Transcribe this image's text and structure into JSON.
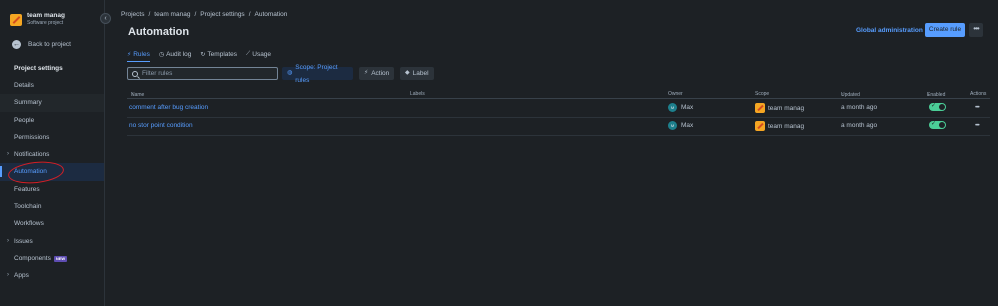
{
  "sidebar": {
    "project_name": "team manag",
    "project_type": "Software project",
    "collapse_icon": "‹",
    "back_label": "Back to project",
    "section_title": "Project settings",
    "items": [
      {
        "label": "Details",
        "chevron": false
      },
      {
        "label": "Summary",
        "chevron": false
      },
      {
        "label": "People",
        "chevron": false
      },
      {
        "label": "Permissions",
        "chevron": false
      },
      {
        "label": "Notifications",
        "chevron": true
      },
      {
        "label": "Automation",
        "chevron": false
      },
      {
        "label": "Features",
        "chevron": false
      },
      {
        "label": "Toolchain",
        "chevron": false
      },
      {
        "label": "Workflows",
        "chevron": false
      },
      {
        "label": "Issues",
        "chevron": true
      },
      {
        "label": "Components",
        "chevron": false,
        "badge": "NEW"
      },
      {
        "label": "Apps",
        "chevron": true
      }
    ]
  },
  "breadcrumb": [
    "Projects",
    "team manag",
    "Project settings",
    "Automation"
  ],
  "page_title": "Automation",
  "header_actions": {
    "global_admin": "Global administration",
    "create_rule": "Create rule",
    "more": "•••"
  },
  "tabs": [
    {
      "label": "Rules",
      "icon": "lightning-icon",
      "glyph": "⚡",
      "active": true
    },
    {
      "label": "Audit log",
      "icon": "clock-icon",
      "glyph": "◷",
      "active": false
    },
    {
      "label": "Templates",
      "icon": "template-icon",
      "glyph": "↻",
      "active": false
    },
    {
      "label": "Usage",
      "icon": "chart-icon",
      "glyph": "⟋",
      "active": false
    }
  ],
  "filter": {
    "placeholder": "Filter rules"
  },
  "filters": {
    "scope": "Scope: Project rules",
    "action": "Action",
    "label": "Label"
  },
  "table": {
    "columns": {
      "name": "Name",
      "labels": "Labels",
      "owner": "Owner",
      "scope": "Scope",
      "updated": "Updated",
      "enabled": "Enabled",
      "actions": "Actions"
    },
    "rows": [
      {
        "name": "comment after bug creation",
        "owner": "Max",
        "owner_initials": "M",
        "scope": "team manag",
        "updated": "a month ago",
        "enabled": true
      },
      {
        "name": "no stor point condition",
        "owner": "Max",
        "owner_initials": "M",
        "scope": "team manag",
        "updated": "a month ago",
        "enabled": true
      }
    ]
  },
  "colors": {
    "background": "#1d2125",
    "accent": "#579dff",
    "toggle_on": "#4bce97",
    "annotation": "#d41f26"
  }
}
